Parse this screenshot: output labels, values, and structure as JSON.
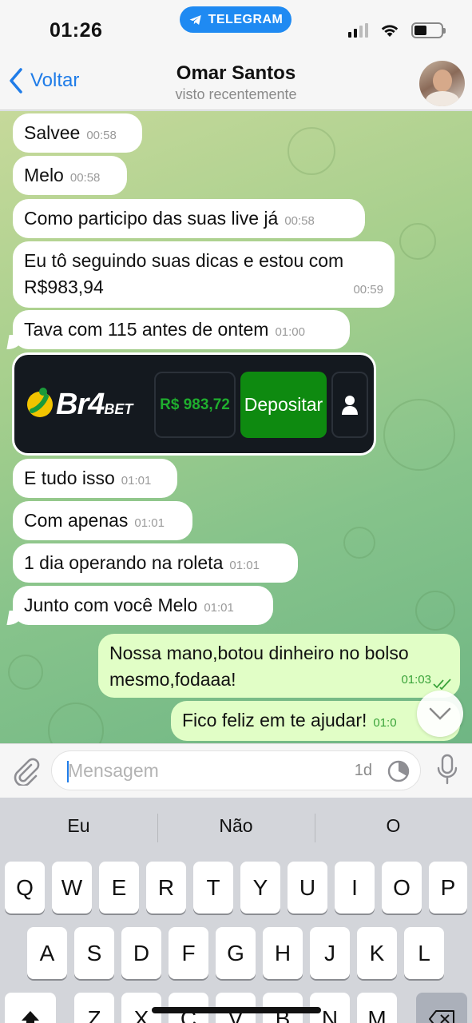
{
  "status_bar": {
    "time": "01:26",
    "source_app": "TELEGRAM"
  },
  "header": {
    "back_label": "Voltar",
    "contact_name": "Omar Santos",
    "contact_status": "visto recentemente"
  },
  "messages": [
    {
      "text": "Salvee",
      "time": "00:58"
    },
    {
      "text": "Melo",
      "time": "00:58"
    },
    {
      "text": "Como participo das suas live já",
      "time": "00:58"
    },
    {
      "text_line1": "Eu tô seguindo suas dicas e estou com",
      "text_line2": "R$983,94",
      "time": "00:59"
    },
    {
      "text": "Tava com 115 antes de ontem",
      "time": "01:00"
    },
    {
      "text": "E tudo isso",
      "time": "01:01"
    },
    {
      "text": "Com apenas",
      "time": "01:01"
    },
    {
      "text": "1 dia operando na roleta",
      "time": "01:01"
    },
    {
      "text": "Junto com você Melo",
      "time": "01:01"
    },
    {
      "text_line1": "Nossa mano,botou dinheiro no bolso",
      "text_line2": "mesmo,fodaaa!",
      "time": "01:03",
      "status": "read"
    },
    {
      "text": "Fico feliz em te ajudar!",
      "time": "01:0"
    }
  ],
  "bet_card": {
    "brand_main": "Br4",
    "brand_small": "BET",
    "balance": "R$ 983,72",
    "deposit_label": "Depositar",
    "balance_color": "#1fae2e",
    "deposit_color": "#0e8a10"
  },
  "composer": {
    "placeholder": "Mensagem",
    "timer": "1d"
  },
  "keyboard": {
    "suggestions": [
      "Eu",
      "Não",
      "O"
    ],
    "row1": [
      "Q",
      "W",
      "E",
      "R",
      "T",
      "Y",
      "U",
      "I",
      "O",
      "P"
    ],
    "row2": [
      "A",
      "S",
      "D",
      "F",
      "G",
      "H",
      "J",
      "K",
      "L"
    ],
    "row3": [
      "Z",
      "X",
      "C",
      "V",
      "B",
      "N",
      "M"
    ]
  },
  "colors": {
    "accent": "#1f7ce8",
    "outgoing_bubble": "#e1fec6",
    "incoming_bubble": "#ffffff"
  }
}
